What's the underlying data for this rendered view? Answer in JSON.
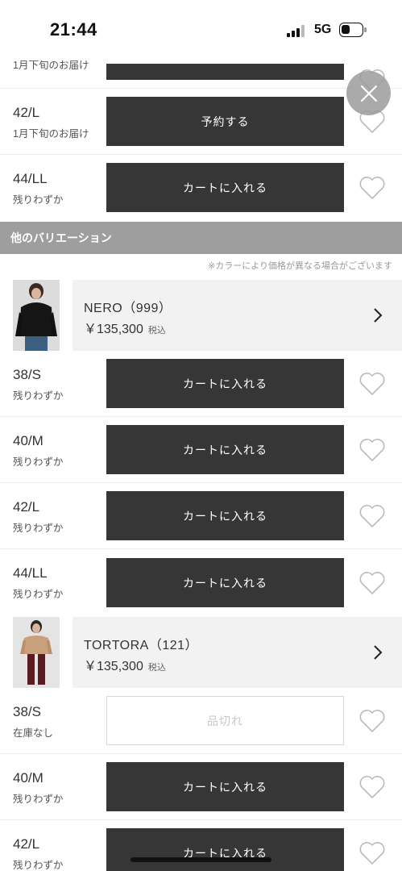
{
  "status_bar": {
    "time": "21:44",
    "network": "5G",
    "battery_level": 0.45
  },
  "top_rows": [
    {
      "size": "",
      "note": "1月下旬のお届け",
      "button": ""
    },
    {
      "size": "42/L",
      "note": "1月下旬のお届け",
      "button": "予約する"
    },
    {
      "size": "44/LL",
      "note": "残りわずか",
      "button": "カートに入れる"
    }
  ],
  "other_variations": {
    "title": "他のバリエーション",
    "note": "※カラーにより価格が異なる場合がございます",
    "variants": [
      {
        "name": "NERO（999）",
        "price": "￥135,300",
        "tax_label": "税込",
        "rows": [
          {
            "size": "38/S",
            "note": "残りわずか",
            "button": "カートに入れる"
          },
          {
            "size": "40/M",
            "note": "残りわずか",
            "button": "カートに入れる"
          },
          {
            "size": "42/L",
            "note": "残りわずか",
            "button": "カートに入れる"
          },
          {
            "size": "44/LL",
            "note": "残りわずか",
            "button": "カートに入れる"
          }
        ]
      },
      {
        "name": "TORTORA（121）",
        "price": "￥135,300",
        "tax_label": "税込",
        "rows": [
          {
            "size": "38/S",
            "note": "在庫なし",
            "button": "品切れ"
          },
          {
            "size": "40/M",
            "note": "残りわずか",
            "button": "カートに入れる"
          },
          {
            "size": "42/L",
            "note": "残りわずか",
            "button": "カートに入れる"
          }
        ]
      }
    ]
  },
  "colors": {
    "button_dark": "#363636",
    "section_header": "#9e9e9e",
    "variant_bg": "#f2f2f2"
  },
  "icons": [
    "heart-outline-icon",
    "chevron-right-icon",
    "close-icon"
  ]
}
